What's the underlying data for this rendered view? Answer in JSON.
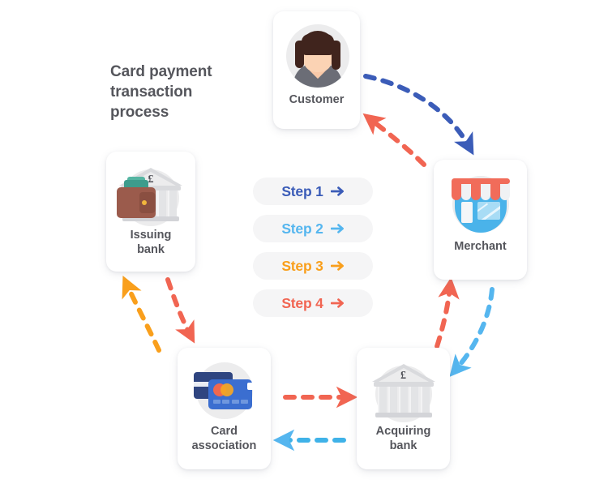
{
  "title": "Card payment\ntransaction\nprocess",
  "title_lines": [
    "Card payment",
    "transaction",
    "process"
  ],
  "colors": {
    "step1": "#3b5cb8",
    "step2": "#55b6ef",
    "step3": "#f99f1c",
    "step4": "#f16552",
    "pill_bg": "#f5f5f6",
    "label_text": "#55565c",
    "page_bg": "#ffffff"
  },
  "legend": {
    "steps": [
      {
        "label": "Step 1",
        "color_key": "step1",
        "arrow": "arrow-right-icon"
      },
      {
        "label": "Step 2",
        "color_key": "step2",
        "arrow": "arrow-right-icon"
      },
      {
        "label": "Step 3",
        "color_key": "step3",
        "arrow": "arrow-right-icon"
      },
      {
        "label": "Step 4",
        "color_key": "step4",
        "arrow": "arrow-right-icon"
      }
    ]
  },
  "nodes": {
    "customer": {
      "label": "Customer",
      "icon": "person-avatar-icon"
    },
    "merchant": {
      "label": "Merchant",
      "icon": "shop-storefront-icon"
    },
    "issuing": {
      "label": "Issuing\nbank",
      "label_line1": "Issuing",
      "label_line2": "bank",
      "icon": "bank-building-wallet-icon",
      "currency": "£"
    },
    "cardassoc": {
      "label": "Card\nassociation",
      "label_line1": "Card",
      "label_line2": "association",
      "icon": "credit-cards-icon"
    },
    "acquiring": {
      "label": "Acquiring\nbank",
      "label_line1": "Acquiring",
      "label_line2": "bank",
      "icon": "bank-building-icon",
      "currency": "£"
    }
  },
  "flows": [
    {
      "name": "customer-to-merchant",
      "from": "customer",
      "to": "merchant",
      "step": "Step 1",
      "color_key": "step1"
    },
    {
      "name": "merchant-to-acquiring",
      "from": "merchant",
      "to": "acquiring",
      "step": "Step 2",
      "color_key": "step2"
    },
    {
      "name": "acquiring-to-cardassoc",
      "from": "acquiring",
      "to": "cardassoc",
      "step": "Step 2",
      "color_key": "step2"
    },
    {
      "name": "cardassoc-to-issuing",
      "from": "cardassoc",
      "to": "issuing",
      "step": "Step 3",
      "color_key": "step3"
    },
    {
      "name": "issuing-to-cardassoc",
      "from": "issuing",
      "to": "cardassoc",
      "step": "Step 4",
      "color_key": "step4"
    },
    {
      "name": "cardassoc-to-acquiring",
      "from": "cardassoc",
      "to": "acquiring",
      "step": "Step 4",
      "color_key": "step4"
    },
    {
      "name": "acquiring-to-merchant",
      "from": "acquiring",
      "to": "merchant",
      "step": "Step 4",
      "color_key": "step4"
    },
    {
      "name": "merchant-to-customer",
      "from": "merchant",
      "to": "customer",
      "step": "Step 4",
      "color_key": "step4"
    }
  ]
}
